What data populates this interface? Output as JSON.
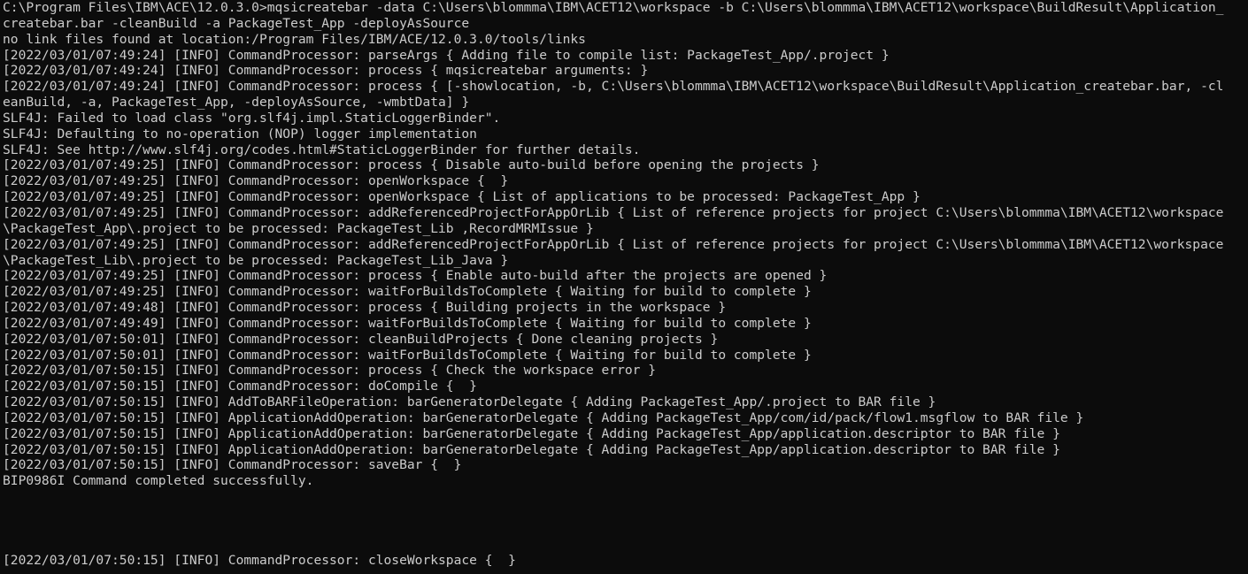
{
  "terminal": {
    "lines": [
      "C:\\Program Files\\IBM\\ACE\\12.0.3.0>mqsicreatebar -data C:\\Users\\blommma\\IBM\\ACET12\\workspace -b C:\\Users\\blommma\\IBM\\ACET12\\workspace\\BuildResult\\Application_",
      "createbar.bar -cleanBuild -a PackageTest_App -deployAsSource",
      "no link files found at location:/Program Files/IBM/ACE/12.0.3.0/tools/links",
      "[2022/03/01/07:49:24] [INFO] CommandProcessor: parseArgs { Adding file to compile list: PackageTest_App/.project }",
      "[2022/03/01/07:49:24] [INFO] CommandProcessor: process { mqsicreatebar arguments: }",
      "[2022/03/01/07:49:24] [INFO] CommandProcessor: process { [-showlocation, -b, C:\\Users\\blommma\\IBM\\ACET12\\workspace\\BuildResult\\Application_createbar.bar, -cl",
      "eanBuild, -a, PackageTest_App, -deployAsSource, -wmbtData] }",
      "SLF4J: Failed to load class \"org.slf4j.impl.StaticLoggerBinder\".",
      "SLF4J: Defaulting to no-operation (NOP) logger implementation",
      "SLF4J: See http://www.slf4j.org/codes.html#StaticLoggerBinder for further details.",
      "[2022/03/01/07:49:25] [INFO] CommandProcessor: process { Disable auto-build before opening the projects }",
      "[2022/03/01/07:49:25] [INFO] CommandProcessor: openWorkspace {  }",
      "[2022/03/01/07:49:25] [INFO] CommandProcessor: openWorkspace { List of applications to be processed: PackageTest_App }",
      "[2022/03/01/07:49:25] [INFO] CommandProcessor: addReferencedProjectForAppOrLib { List of reference projects for project C:\\Users\\blommma\\IBM\\ACET12\\workspace",
      "\\PackageTest_App\\.project to be processed: PackageTest_Lib ,RecordMRMIssue }",
      "[2022/03/01/07:49:25] [INFO] CommandProcessor: addReferencedProjectForAppOrLib { List of reference projects for project C:\\Users\\blommma\\IBM\\ACET12\\workspace",
      "\\PackageTest_Lib\\.project to be processed: PackageTest_Lib_Java }",
      "[2022/03/01/07:49:25] [INFO] CommandProcessor: process { Enable auto-build after the projects are opened }",
      "[2022/03/01/07:49:25] [INFO] CommandProcessor: waitForBuildsToComplete { Waiting for build to complete }",
      "[2022/03/01/07:49:48] [INFO] CommandProcessor: process { Building projects in the workspace }",
      "[2022/03/01/07:49:49] [INFO] CommandProcessor: waitForBuildsToComplete { Waiting for build to complete }",
      "[2022/03/01/07:50:01] [INFO] CommandProcessor: cleanBuildProjects { Done cleaning projects }",
      "[2022/03/01/07:50:01] [INFO] CommandProcessor: waitForBuildsToComplete { Waiting for build to complete }",
      "[2022/03/01/07:50:15] [INFO] CommandProcessor: process { Check the workspace error }",
      "[2022/03/01/07:50:15] [INFO] CommandProcessor: doCompile {  }",
      "[2022/03/01/07:50:15] [INFO] AddToBARFileOperation: barGeneratorDelegate { Adding PackageTest_App/.project to BAR file }",
      "[2022/03/01/07:50:15] [INFO] ApplicationAddOperation: barGeneratorDelegate { Adding PackageTest_App/com/id/pack/flow1.msgflow to BAR file }",
      "[2022/03/01/07:50:15] [INFO] ApplicationAddOperation: barGeneratorDelegate { Adding PackageTest_App/application.descriptor to BAR file }",
      "[2022/03/01/07:50:15] [INFO] ApplicationAddOperation: barGeneratorDelegate { Adding PackageTest_App/application.descriptor to BAR file }",
      "[2022/03/01/07:50:15] [INFO] CommandProcessor: saveBar {  }",
      "BIP0986I Command completed successfully."
    ],
    "final_line": "[2022/03/01/07:50:15] [INFO] CommandProcessor: closeWorkspace {  }"
  }
}
